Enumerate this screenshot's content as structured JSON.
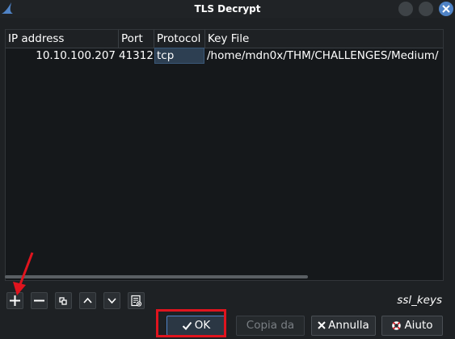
{
  "window": {
    "title": "TLS Decrypt"
  },
  "table": {
    "columns": [
      "IP address",
      "Port",
      "Protocol",
      "Key File"
    ],
    "rows": [
      {
        "ip": "10.10.100.207",
        "port": "41312",
        "protocol": "tcp",
        "key_file": "/home/mdn0x/THM/CHALLENGES/Medium/"
      }
    ]
  },
  "toolbar": {
    "icons": [
      "plus-icon",
      "minus-icon",
      "copy-icon",
      "up-arrow-icon",
      "down-arrow-icon",
      "clear-icon"
    ]
  },
  "preference_label": "ssl_keys",
  "buttons": {
    "ok": "OK",
    "copy": "Copia da",
    "cancel": "Annulla",
    "help": "Aiuto"
  },
  "colors": {
    "background": "#1e2124",
    "accent": "#4f83c6",
    "annotation": "#e0141e"
  }
}
